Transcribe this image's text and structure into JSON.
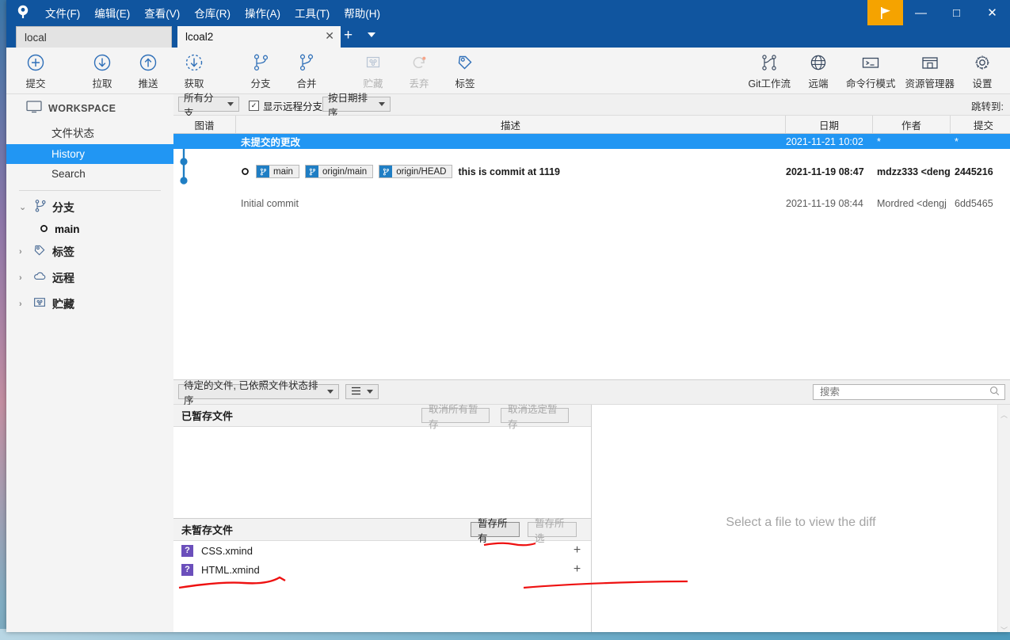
{
  "window": {
    "title_menu": [
      "文件(F)",
      "编辑(E)",
      "查看(V)",
      "仓库(R)",
      "操作(A)",
      "工具(T)",
      "帮助(H)"
    ],
    "controls": {
      "flag": "⚑",
      "minimize": "—",
      "maximize": "□",
      "close": "✕"
    },
    "accent": "#10559f",
    "highlight": "#2196f3"
  },
  "tabs": {
    "items": [
      {
        "label": "local",
        "active": false
      },
      {
        "label": "lcoal2",
        "active": true
      }
    ],
    "close_icon": "✕",
    "new_tab_icon": "+"
  },
  "toolbar": {
    "left": [
      {
        "label": "提交",
        "icon": "plus-circle-icon",
        "disabled": false
      },
      {
        "label": "拉取",
        "icon": "arrow-down-circle-icon",
        "disabled": false
      },
      {
        "label": "推送",
        "icon": "arrow-up-circle-icon",
        "disabled": false
      },
      {
        "label": "获取",
        "icon": "fetch-dashed-circle-icon",
        "disabled": false
      },
      {
        "label": "分支",
        "icon": "branch-icon",
        "disabled": false
      },
      {
        "label": "合并",
        "icon": "merge-icon",
        "disabled": false
      },
      {
        "label": "贮藏",
        "icon": "stash-icon",
        "disabled": true
      },
      {
        "label": "丢弃",
        "icon": "discard-refresh-icon",
        "disabled": true
      },
      {
        "label": "标签",
        "icon": "tag-icon",
        "disabled": false
      }
    ],
    "right": [
      {
        "label": "Git工作流",
        "icon": "gitflow-icon"
      },
      {
        "label": "远端",
        "icon": "globe-icon"
      },
      {
        "label": "命令行模式",
        "icon": "terminal-icon"
      },
      {
        "label": "资源管理器",
        "icon": "explorer-icon"
      },
      {
        "label": "设置",
        "icon": "gear-icon"
      }
    ]
  },
  "sidebar": {
    "workspace_label": "WORKSPACE",
    "workspace_items": [
      {
        "label": "文件状态",
        "selected": false
      },
      {
        "label": "History",
        "selected": true
      },
      {
        "label": "Search",
        "selected": false
      }
    ],
    "sections": [
      {
        "label": "分支",
        "icon": "branch-icon",
        "expanded": true,
        "arrow": "⌄",
        "children": [
          {
            "label": "main",
            "icon": "commit-dot-icon"
          }
        ]
      },
      {
        "label": "标签",
        "icon": "tag-icon",
        "expanded": false,
        "arrow": "›",
        "children": []
      },
      {
        "label": "远程",
        "icon": "cloud-icon",
        "expanded": false,
        "arrow": "›",
        "children": []
      },
      {
        "label": "贮藏",
        "icon": "stash-icon",
        "expanded": false,
        "arrow": "›",
        "children": []
      }
    ]
  },
  "history": {
    "filters": {
      "branch_select": "所有分支",
      "show_remote_label": "显示远程分支",
      "show_remote_checked": true,
      "sort_select": "按日期排序",
      "jump_to_label": "跳转到:"
    },
    "columns": [
      "图谱",
      "描述",
      "日期",
      "作者",
      "提交"
    ],
    "rows": [
      {
        "selected": true,
        "description": "未提交的更改",
        "refs": [],
        "date": "2021-11-21 10:02",
        "author": "*",
        "commit": "*",
        "bold": true
      },
      {
        "selected": false,
        "description": "this is commit at 1119",
        "refs": [
          "main",
          "origin/main",
          "origin/HEAD"
        ],
        "date": "2021-11-19 08:47",
        "author": "mdzz333 <deng",
        "commit": "2445216",
        "bold": true
      },
      {
        "selected": false,
        "description": "Initial commit",
        "refs": [],
        "date": "2021-11-19 08:44",
        "author": "Mordred <dengj",
        "commit": "6dd5465",
        "bold": false
      }
    ]
  },
  "files": {
    "sort_select": "待定的文件, 已依照文件状态排序",
    "view_icon": "list-view-icon",
    "search_placeholder": "搜索",
    "search_value": "",
    "search_icon": "search-icon",
    "staged": {
      "title": "已暂存文件",
      "buttons": [
        {
          "label": "取消所有暂存",
          "enabled": false
        },
        {
          "label": "取消选定暂存",
          "enabled": false
        }
      ],
      "items": []
    },
    "unstaged": {
      "title": "未暂存文件",
      "buttons": [
        {
          "label": "暂存所有",
          "enabled": true
        },
        {
          "label": "暂存所选",
          "enabled": false
        }
      ],
      "items": [
        {
          "name": "CSS.xmind",
          "status": "?",
          "add_icon": "+"
        },
        {
          "name": "HTML.xmind",
          "status": "?",
          "add_icon": "+"
        }
      ]
    }
  },
  "diff": {
    "placeholder": "Select a file to view the diff"
  }
}
